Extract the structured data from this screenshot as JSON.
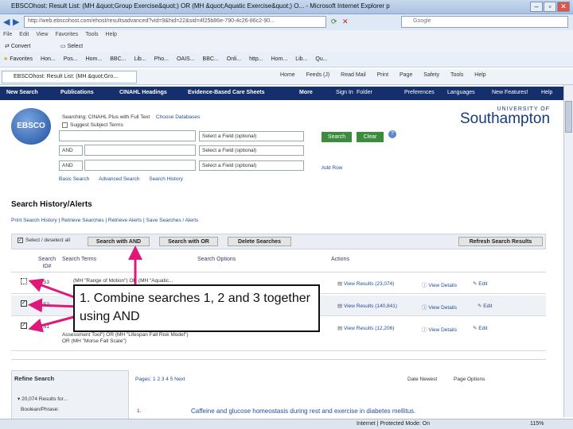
{
  "browser": {
    "title": "EBSCOhost: Result List: (MH &quot;Group Exercise&quot;) OR (MH &quot;Aquatic Exercise&quot;) O... - Microsoft Internet Explorer p",
    "address": "http://web.ebscohost.com/ehost/resultsadvanced?vid=9&hid=22&sid=4f25b86e-790-4c26-86c2-90...",
    "search_placeholder": "Google",
    "menu": [
      "File",
      "Edit",
      "View",
      "Favorites",
      "Tools",
      "Help"
    ],
    "convert_label": "Convert",
    "select_label": "Select",
    "favorites_label": "Favorites",
    "favorites_items": [
      "Hon...",
      "Pos...",
      "Hom...",
      "BBC...",
      "Lib...",
      "Pho...",
      "OAIS...",
      "BBC...",
      "Onli...",
      "http...",
      "Hom...",
      "Lib...",
      "Qu..."
    ],
    "tab_label": "EBSCOhost: Result List: (MH &quot;Gro...",
    "cmd_tools": [
      "Home",
      "Feeds (J)",
      "Read Mail",
      "Print",
      "Page",
      "Safety",
      "Tools",
      "Help"
    ]
  },
  "nav": {
    "items": [
      "New Search",
      "Publications",
      "CINAHL Headings",
      "Evidence-Based Care Sheets",
      "More",
      "Sign In",
      "Folder",
      "Preferences",
      "Languages",
      "New Features!",
      "Help"
    ]
  },
  "search": {
    "logo_text": "EBSCO",
    "searching_label": "Searching: CINAHL Plus with Full Text",
    "choose_db": "Choose Databases",
    "suggest_label": "Suggest Subject Terms",
    "field_placeholder": "Select a Field (optional)",
    "bool_op": "AND",
    "search_button": "Search",
    "clear_button": "Clear",
    "add_row": "Add Row",
    "links": [
      "Basic Search",
      "Advanced Search",
      "Search History"
    ]
  },
  "university": {
    "line1": "UNIVERSITY OF",
    "line2": "Southampton"
  },
  "history": {
    "title": "Search History/Alerts",
    "links": [
      "Print Search History",
      "Retrieve Searches",
      "Retrieve Alerts",
      "Save Searches / Alerts"
    ],
    "select_all": "Select / deselect all",
    "btn_and": "Search with AND",
    "btn_or": "Search with OR",
    "btn_delete": "Delete Searches",
    "btn_refresh": "Refresh Search Results",
    "col_id": "Search ID#",
    "col_terms": "Search Terms",
    "col_options": "Search Options",
    "col_actions": "Actions",
    "rows": [
      {
        "id": "S3",
        "terms": "(MH \"Range of Motion\") OR (MH \"Aquatic...",
        "results": "View Results (23,074)",
        "details": "View Details",
        "edit": "Edit"
      },
      {
        "id": "S2",
        "terms": "",
        "results": "View Results (140,841)",
        "details": "View Details",
        "edit": "Edit"
      },
      {
        "id": "S1",
        "terms": "Assessment Tool\") OR (MH \"Lifespan Fall Risk Model\") OR (MH \"Morse Fall Scale\")",
        "results": "View Results (12,206)",
        "details": "View Details",
        "edit": "Edit"
      }
    ]
  },
  "callout": {
    "text": "1. Combine searches 1, 2 and 3 together using  AND"
  },
  "refine": {
    "title": "Refine Search",
    "results_for": "20,074 Results for...",
    "boolean": "Boolean/Phrase:"
  },
  "results": {
    "pages": "Pages: 1 2 3 4 5 Next",
    "sort": "Date Newest",
    "page_options": "Page Options",
    "item_number": "1.",
    "item_title": "Caffeine and glucose homeostasis during rest and exercise in diabetes mellitus."
  },
  "status": {
    "zone": "Internet | Protected Mode: On",
    "zoom": "115%"
  }
}
